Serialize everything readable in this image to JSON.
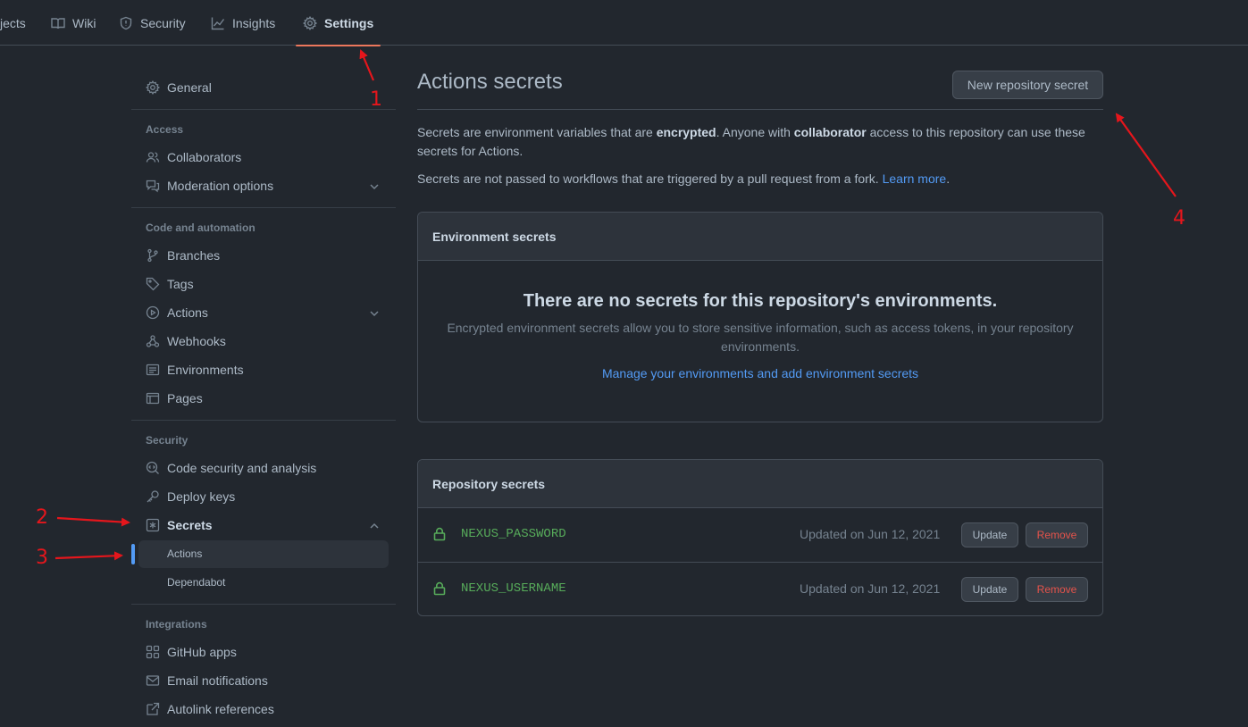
{
  "topnav": {
    "tabs": [
      {
        "label": "jects",
        "icon": "projects-icon"
      },
      {
        "label": "Wiki",
        "icon": "book-icon"
      },
      {
        "label": "Security",
        "icon": "shield-icon"
      },
      {
        "label": "Insights",
        "icon": "graph-icon"
      },
      {
        "label": "Settings",
        "icon": "gear-icon",
        "active": true
      }
    ]
  },
  "sidebar": {
    "general": "General",
    "sections": {
      "access": "Access",
      "code_automation": "Code and automation",
      "security": "Security",
      "integrations": "Integrations"
    },
    "items": {
      "collaborators": "Collaborators",
      "moderation": "Moderation options",
      "branches": "Branches",
      "tags": "Tags",
      "actions": "Actions",
      "webhooks": "Webhooks",
      "environments": "Environments",
      "pages": "Pages",
      "code_security": "Code security and analysis",
      "deploy_keys": "Deploy keys",
      "secrets": "Secrets",
      "secrets_actions": "Actions",
      "secrets_dependabot": "Dependabot",
      "github_apps": "GitHub apps",
      "email_notifications": "Email notifications",
      "autolink": "Autolink references"
    }
  },
  "main": {
    "title": "Actions secrets",
    "new_button": "New repository secret",
    "desc1": {
      "a": "Secrets are environment variables that are ",
      "b": "encrypted",
      "c": ". Anyone with ",
      "d": "collaborator",
      "e": " access to this repository can use these secrets for Actions."
    },
    "desc2": {
      "a": "Secrets are not passed to workflows that are triggered by a pull request from a fork. ",
      "link": "Learn more",
      "end": "."
    },
    "env_box": {
      "header": "Environment secrets",
      "blank_title": "There are no secrets for this repository's environments.",
      "blank_desc": "Encrypted environment secrets allow you to store sensitive information, such as access tokens, in your repository environments.",
      "link": "Manage your environments and add environment secrets"
    },
    "repo_box": {
      "header": "Repository secrets",
      "secrets": [
        {
          "name": "NEXUS_PASSWORD",
          "updated": "Updated on Jun 12, 2021",
          "update": "Update",
          "remove": "Remove"
        },
        {
          "name": "NEXUS_USERNAME",
          "updated": "Updated on Jun 12, 2021",
          "update": "Update",
          "remove": "Remove"
        }
      ]
    }
  },
  "annotations": {
    "n1": "1",
    "n2": "2",
    "n3": "3",
    "n4": "4",
    "color": "#e5161c"
  },
  "colors": {
    "accent": "#539bf5",
    "green": "#57ab5a",
    "danger": "#e5534b",
    "tab_underline": "#ec775c"
  }
}
